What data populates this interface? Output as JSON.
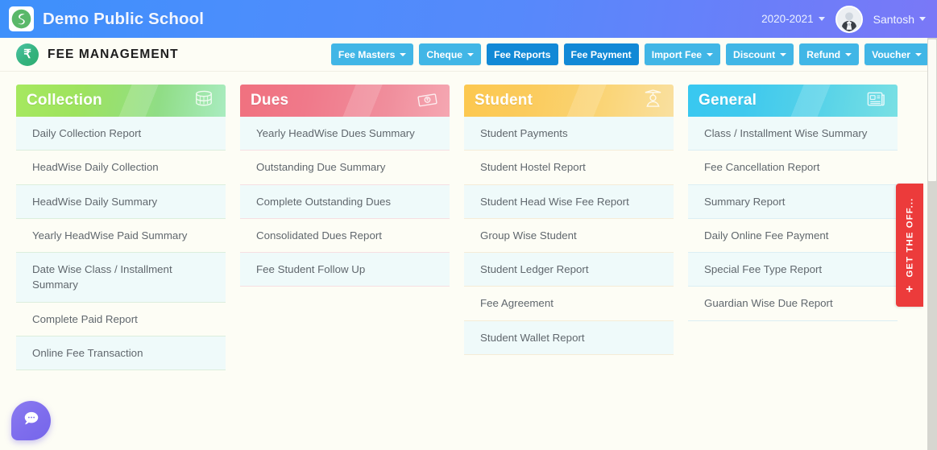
{
  "header": {
    "brand_name": "Demo Public School",
    "logo_icon": "school-logo-icon",
    "session": "2020-2021",
    "user_name": "Santosh",
    "avatar_icon": "user-avatar"
  },
  "module_bar": {
    "module_icon": "rupee-icon",
    "module_title": "FEE MANAGEMENT",
    "buttons": [
      {
        "label": "Fee Masters",
        "has_caret": true,
        "active": false
      },
      {
        "label": "Cheque",
        "has_caret": true,
        "active": false
      },
      {
        "label": "Fee Reports",
        "has_caret": false,
        "active": true
      },
      {
        "label": "Fee Payment",
        "has_caret": false,
        "active": true
      },
      {
        "label": "Import Fee",
        "has_caret": true,
        "active": false
      },
      {
        "label": "Discount",
        "has_caret": true,
        "active": false
      },
      {
        "label": "Refund",
        "has_caret": true,
        "active": false
      },
      {
        "label": "Voucher",
        "has_caret": true,
        "active": false
      }
    ]
  },
  "cards": [
    {
      "title": "Collection",
      "icon": "coins-stack-icon",
      "accent": "#9ee35e",
      "items": [
        "Daily Collection Report",
        "HeadWise Daily Collection",
        "HeadWise Daily Summary",
        "Yearly HeadWise Paid Summary",
        "Date Wise Class / Installment Summary",
        "Complete Paid Report",
        "Online Fee Transaction"
      ]
    },
    {
      "title": "Dues",
      "icon": "banknote-icon",
      "accent": "#f0798a",
      "items": [
        "Yearly HeadWise Dues Summary",
        "Outstanding Due Summary",
        "Complete Outstanding Dues",
        "Consolidated Dues Report",
        "Fee Student Follow Up"
      ]
    },
    {
      "title": "Student",
      "icon": "graduate-icon",
      "accent": "#fbcb5c",
      "items": [
        "Student Payments",
        "Student Hostel Report",
        "Student Head Wise Fee Report",
        "Group Wise Student",
        "Student Ledger Report",
        "Fee Agreement",
        "Student Wallet Report"
      ]
    },
    {
      "title": "General",
      "icon": "newspaper-icon",
      "accent": "#3fc9ee",
      "items": [
        "Class / Installment Wise Summary",
        "Fee Cancellation Report",
        "Summary Report",
        "Daily Online Fee Payment",
        "Special Fee Type Report",
        "Guardian Wise Due Report"
      ]
    }
  ],
  "offer_tab": {
    "label": "GET THE OFF...",
    "plus_icon": "plus-icon",
    "color": "#ec3b3b"
  },
  "chat_widget": {
    "icon": "chat-bubble-icon"
  }
}
